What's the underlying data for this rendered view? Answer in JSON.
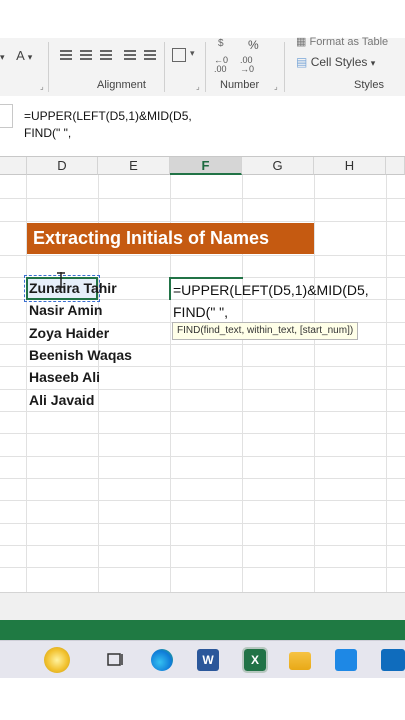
{
  "ribbon": {
    "groups": {
      "alignment": "Alignment",
      "number": "Number",
      "styles": "Styles"
    },
    "format_as_table": "Format as Table",
    "cell_styles": "Cell Styles",
    "percent_symbol": "%",
    "currency_symbol": "$",
    "font_color_glyph": "A"
  },
  "formula_bar": {
    "line1": "=UPPER(LEFT(D5,1)&MID(D5,",
    "line2": "FIND(\" \","
  },
  "columns": [
    "D",
    "E",
    "F",
    "G",
    "H"
  ],
  "active_column": "F",
  "title": "Extracting Initials of Names",
  "names": [
    "Zunaira Tahir",
    "Nasir Amin",
    "Zoya Haider",
    "Beenish Waqas",
    "Haseeb Ali",
    "Ali Javaid"
  ],
  "editing": {
    "line1": "=UPPER(LEFT(D5,1)&MID(D5,",
    "line2": "FIND(\" \","
  },
  "tooltip": "FIND(find_text, within_text, [start_num])",
  "colors": {
    "excel_green": "#217346",
    "title_fill": "#c55a11",
    "status_bar": "#1f7a43"
  },
  "taskbar_icons": [
    "search-icon",
    "task-view-icon",
    "edge-icon",
    "word-icon",
    "excel-icon",
    "file-explorer-icon",
    "store-icon",
    "mail-icon"
  ]
}
